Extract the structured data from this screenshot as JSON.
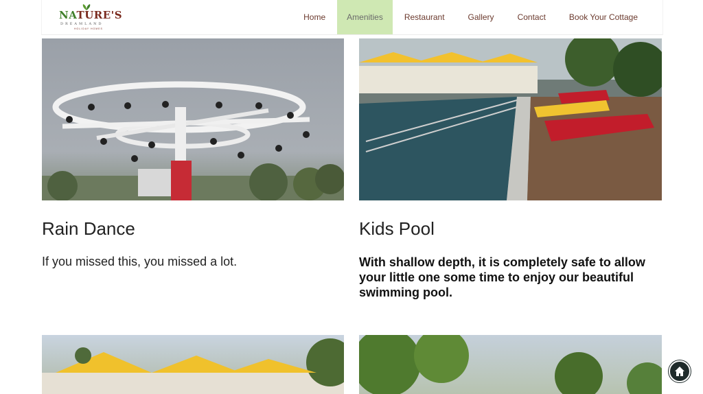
{
  "logo": {
    "word_1": "NA",
    "word_2": "TURE'S",
    "line_2": "DREAMLAND",
    "line_3": "HOLIDAY HOMES",
    "colors": {
      "brand_brown": "#7a2a1e",
      "brand_green": "#3f7f2a"
    }
  },
  "nav": {
    "items": [
      {
        "label": "Home"
      },
      {
        "label": "Amenities",
        "active": true
      },
      {
        "label": "Restaurant"
      },
      {
        "label": "Gallery"
      },
      {
        "label": "Contact"
      },
      {
        "label": "Book Your Cottage"
      }
    ],
    "active_color": "#cfe8b3"
  },
  "amenities": [
    {
      "title": "Rain Dance",
      "description": "If you missed this, you missed a lot.",
      "image_icon": "rain-dance-sprinkler"
    },
    {
      "title": "Kids Pool",
      "description": "With shallow depth, it is completely safe to allow your little one some time to enjoy our beautiful swimming pool.",
      "image_icon": "swimming-pool"
    }
  ],
  "back_to_top_icon": "home-icon"
}
